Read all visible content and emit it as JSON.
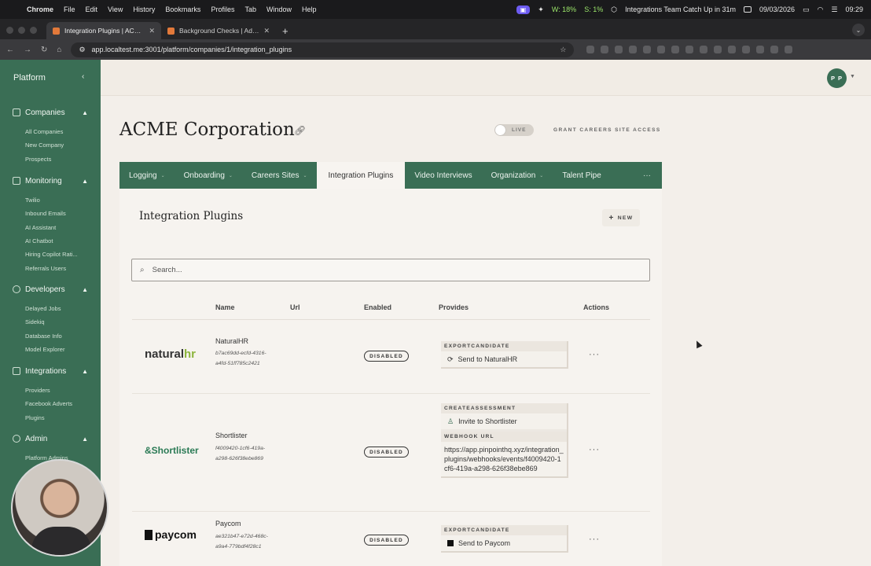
{
  "menubar": {
    "app": "Chrome",
    "items": [
      "File",
      "Edit",
      "View",
      "History",
      "Bookmarks",
      "Profiles",
      "Tab",
      "Window",
      "Help"
    ],
    "stat_w": "W: 18%",
    "stat_s": "S: 1%",
    "event": "Integrations Team Catch Up in 31m",
    "date": "09/03/2026",
    "time": "09:29"
  },
  "tabs": [
    {
      "title": "Integration Plugins | ACME C"
    },
    {
      "title": "Background Checks | Adam H"
    }
  ],
  "address": {
    "url": "app.localtest.me:3001/platform/companies/1/integration_plugins"
  },
  "sidebar": {
    "brand": "Platform",
    "sections": [
      {
        "label": "Companies",
        "items": [
          "All Companies",
          "New Company",
          "Prospects"
        ]
      },
      {
        "label": "Monitoring",
        "items": [
          "Twilio",
          "Inbound Emails",
          "AI Assistant",
          "AI Chatbot",
          "Hiring Copilot Rati...",
          "Referrals Users"
        ]
      },
      {
        "label": "Developers",
        "items": [
          "Delayed Jobs",
          "Sidekiq",
          "Database Info",
          "Model Explorer"
        ]
      },
      {
        "label": "Integrations",
        "items": [
          "Providers",
          "Facebook Adverts",
          "Plugins"
        ]
      },
      {
        "label": "Admin",
        "items": [
          "Platform Admins"
        ]
      }
    ]
  },
  "user": {
    "initials": "P P"
  },
  "company": {
    "title": "ACME Corporation",
    "live_label": "LIVE",
    "grant_label": "GRANT CAREERS SITE ACCESS"
  },
  "company_tabs": [
    "Logging",
    "Onboarding",
    "Careers Sites",
    "Integration Plugins",
    "Video Interviews",
    "Organization",
    "Talent Pipe"
  ],
  "panel": {
    "title": "Integration Plugins",
    "new_label": "NEW",
    "search_placeholder": "Search..."
  },
  "table": {
    "headers": {
      "name": "Name",
      "url": "Url",
      "enabled": "Enabled",
      "provides": "Provides",
      "actions": "Actions"
    },
    "rows": [
      {
        "logo": "naturalhr",
        "name": "NaturalHR",
        "id": "b7ac69dd-ecfd-4316-a4fd-51ff785c2421",
        "status": "DISABLED",
        "provides": [
          {
            "label": "EXPORTCANDIDATE",
            "action": "Send to NaturalHR"
          }
        ]
      },
      {
        "logo": "Shortlister",
        "name": "Shortlister",
        "id": "f4009420-1cf6-419a-a298-626f38ebe869",
        "status": "DISABLED",
        "provides": [
          {
            "label": "CREATEASSESSMENT",
            "action": "Invite to Shortlister"
          }
        ],
        "webhook_label": "WEBHOOK URL",
        "webhook_url": "https://app.pinpointhq.xyz/integration_plugins/webhooks/events/f4009420-1cf6-419a-a298-626f38ebe869"
      },
      {
        "logo": "paycom",
        "name": "Paycom",
        "id": "ae321b47-e72d-468c-a9a4-779bdf4f28c1",
        "status": "DISABLED",
        "provides": [
          {
            "label": "EXPORTCANDIDATE",
            "action": "Send to Paycom"
          }
        ]
      }
    ]
  },
  "colors": {
    "sidebar": "#3a6e55",
    "background": "#f3efea",
    "tabs_bar": "#3a6e55"
  }
}
